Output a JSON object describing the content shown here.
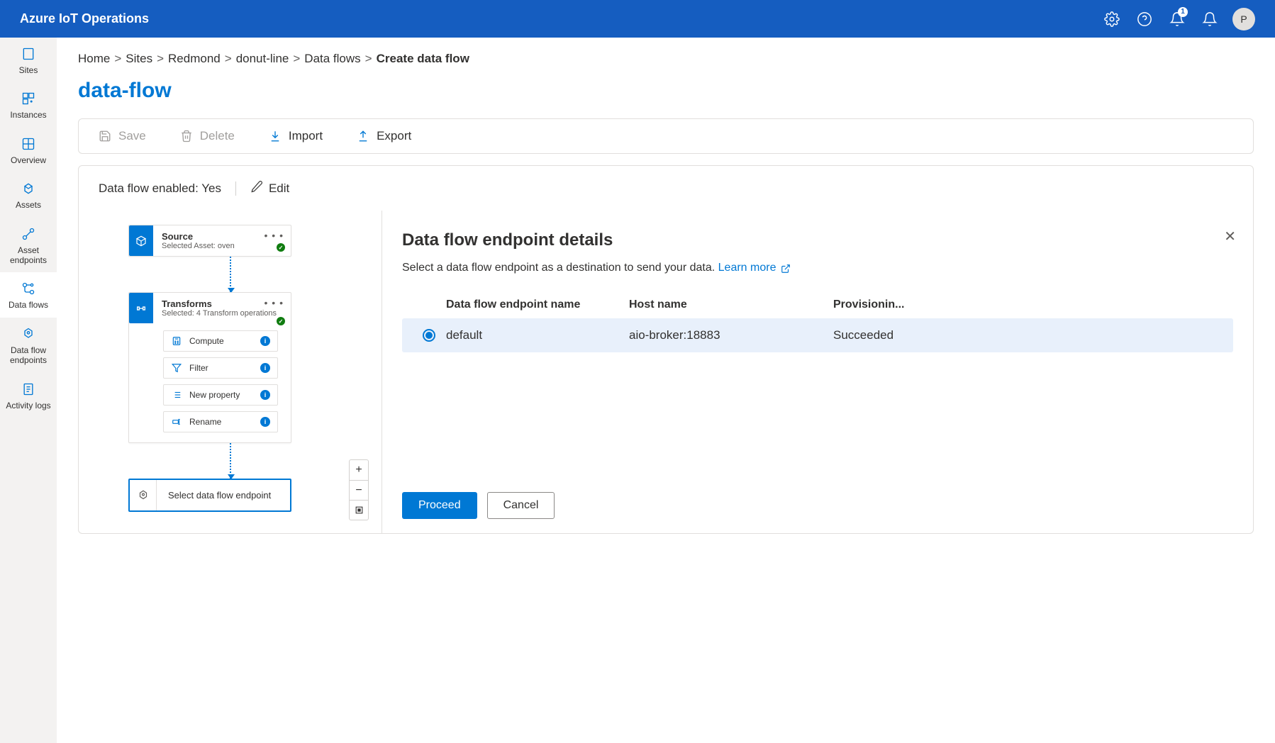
{
  "brand": "Azure IoT Operations",
  "notifications_count": "1",
  "avatar_initial": "P",
  "leftnav": [
    {
      "label": "Sites",
      "name": "sidebar-sites"
    },
    {
      "label": "Instances",
      "name": "sidebar-instances"
    },
    {
      "label": "Overview",
      "name": "sidebar-overview"
    },
    {
      "label": "Assets",
      "name": "sidebar-assets"
    },
    {
      "label": "Asset endpoints",
      "name": "sidebar-asset-endpoints"
    },
    {
      "label": "Data flows",
      "name": "sidebar-data-flows"
    },
    {
      "label": "Data flow endpoints",
      "name": "sidebar-data-flow-endpoints"
    },
    {
      "label": "Activity logs",
      "name": "sidebar-activity-logs"
    }
  ],
  "breadcrumb": {
    "home": "Home",
    "sites": "Sites",
    "site": "Redmond",
    "instance": "donut-line",
    "section": "Data flows",
    "current": "Create data flow"
  },
  "page_title": "data-flow",
  "toolbar": {
    "save": "Save",
    "delete": "Delete",
    "import": "Import",
    "export": "Export"
  },
  "enabled_label": "Data flow enabled: Yes",
  "edit_label": "Edit",
  "source_node": {
    "title": "Source",
    "subtitle": "Selected Asset: oven"
  },
  "transform_node": {
    "title": "Transforms",
    "subtitle": "Selected: 4 Transform operations"
  },
  "ops": {
    "compute": "Compute",
    "filter": "Filter",
    "newprop": "New property",
    "rename": "Rename"
  },
  "dest_node": {
    "label": "Select data flow endpoint"
  },
  "panel": {
    "title": "Data flow endpoint details",
    "desc": "Select a data flow endpoint as a destination to send your data. ",
    "learn_more": "Learn more"
  },
  "table": {
    "head": {
      "c1": "Data flow endpoint name",
      "c2": "Host name",
      "c3": "Provisionin..."
    },
    "row": {
      "name": "default",
      "host": "aio-broker:18883",
      "prov": "Succeeded"
    }
  },
  "buttons": {
    "proceed": "Proceed",
    "cancel": "Cancel"
  }
}
